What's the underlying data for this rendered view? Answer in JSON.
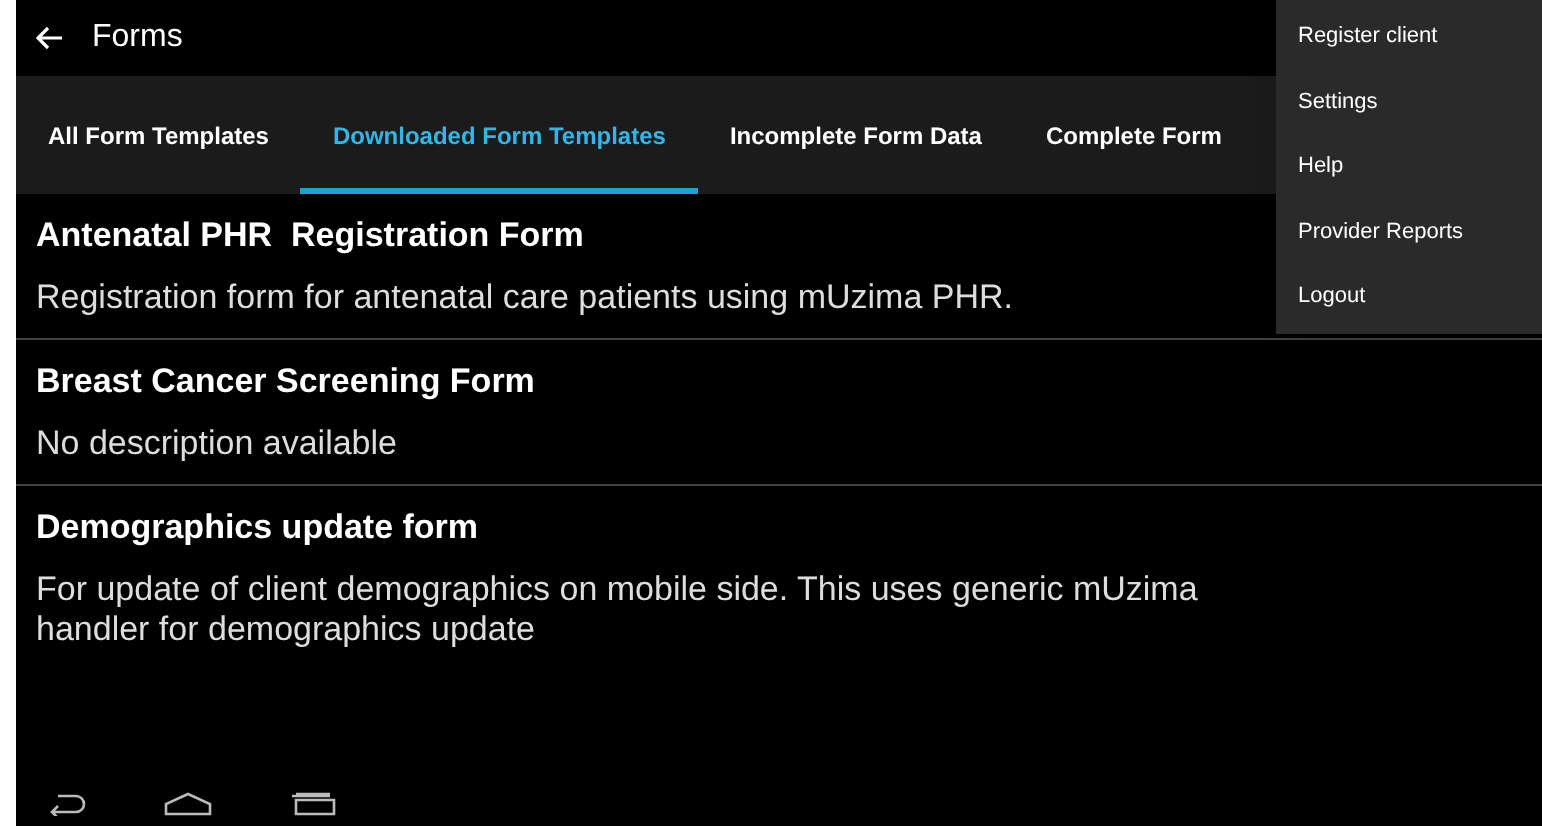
{
  "action_bar": {
    "title": "Forms"
  },
  "tabs": [
    {
      "label": "All Form Templates",
      "selected": false
    },
    {
      "label": "Downloaded Form Templates",
      "selected": true
    },
    {
      "label": "Incomplete Form Data",
      "selected": false
    },
    {
      "label": "Complete Form",
      "selected": false
    }
  ],
  "forms": [
    {
      "name": "Antenatal PHR  Registration Form",
      "description": "Registration form for antenatal care patients using mUzima PHR."
    },
    {
      "name": "Breast Cancer Screening Form",
      "description": "No description available"
    },
    {
      "name": "Demographics update form",
      "description": "For update of client demographics on mobile side. This uses generic mUzima handler for demographics update"
    }
  ],
  "overflow_menu": [
    "Register client",
    "Settings",
    "Help",
    "Provider Reports",
    "Logout"
  ]
}
